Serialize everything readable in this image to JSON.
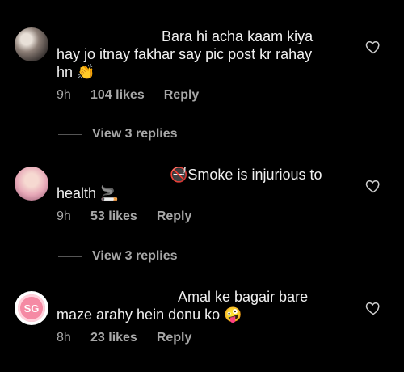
{
  "comments": [
    {
      "username": "",
      "text_line1": "Bara hi acha kaam kiya",
      "text_line2": "hay jo itnay fakhar say pic post kr rahay",
      "text_line3": "hn",
      "emoji": "👏",
      "time": "9h",
      "likes": "104 likes",
      "reply": "Reply",
      "view_replies": "View 3 replies"
    },
    {
      "username": "",
      "text_line1": "Smoke is injurious to",
      "text_line2": "health",
      "emoji_prefix": "🚭",
      "emoji": "🚬",
      "time": "9h",
      "likes": "53 likes",
      "reply": "Reply",
      "view_replies": "View 3 replies"
    },
    {
      "username": "",
      "text_line1": "Amal ke bagair bare",
      "text_line2": "maze arahy hein donu ko",
      "emoji": "🤪",
      "avatar_text": "SG",
      "time": "8h",
      "likes": "23 likes",
      "reply": "Reply"
    }
  ]
}
